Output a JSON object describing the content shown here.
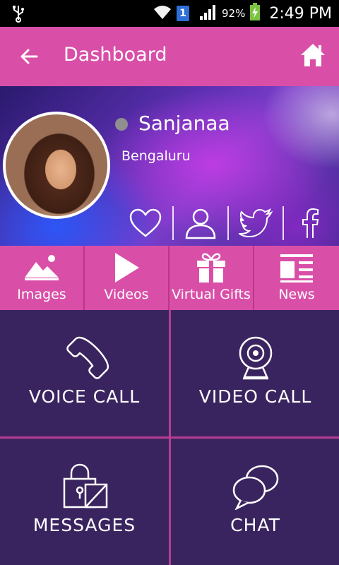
{
  "status_bar": {
    "sim": "1",
    "battery": "92%",
    "time": "2:49 PM"
  },
  "app_bar": {
    "title": "Dashboard"
  },
  "profile": {
    "name": "Sanjanaa",
    "city": "Bengaluru",
    "online_status_color": "#8f8f8f"
  },
  "tiles": [
    {
      "label": "Images",
      "icon": "image-icon"
    },
    {
      "label": "Videos",
      "icon": "play-icon"
    },
    {
      "label": "Virtual Gifts",
      "icon": "gift-icon"
    },
    {
      "label": "News",
      "icon": "news-icon"
    }
  ],
  "actions": [
    {
      "label": "VOICE CALL",
      "icon": "phone-icon"
    },
    {
      "label": "VIDEO CALL",
      "icon": "webcam-icon"
    },
    {
      "label": "MESSAGES",
      "icon": "envelope-lock-icon"
    },
    {
      "label": "CHAT",
      "icon": "chat-bubbles-icon"
    }
  ],
  "colors": {
    "accent_pink": "#d94fa8",
    "grid_purple": "#3a2460",
    "divider_pink": "#b83d92"
  }
}
